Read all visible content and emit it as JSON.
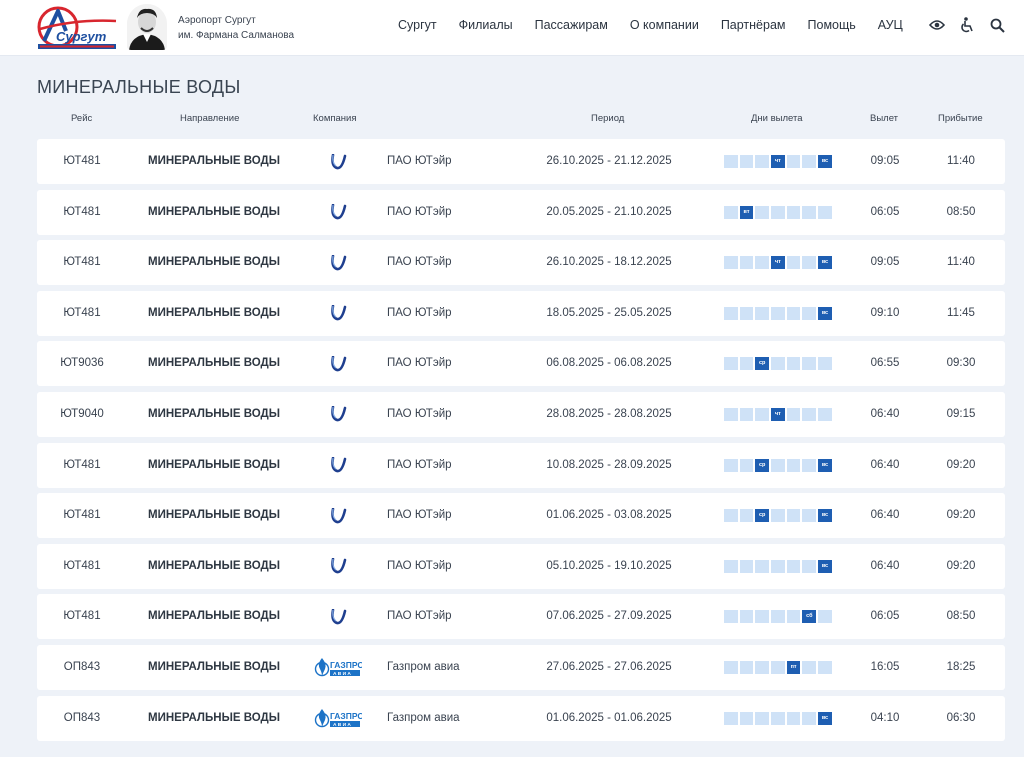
{
  "header": {
    "airport_line1": "Аэропорт Сургут",
    "airport_line2": "им. Фармана Салманова",
    "nav": [
      "Сургут",
      "Филиалы",
      "Пассажирам",
      "О компании",
      "Партнёрам",
      "Помощь",
      "АУЦ"
    ],
    "tools": [
      "eye-icon",
      "accessibility-icon",
      "search-icon"
    ]
  },
  "page_title": "МИНЕРАЛЬНЫЕ ВОДЫ",
  "columns": {
    "flight": "Рейс",
    "direction": "Направление",
    "company": "Компания",
    "period": "Период",
    "days": "Дни вылета",
    "departure": "Вылет",
    "arrival": "Прибытие"
  },
  "colors": {
    "accent": "#1e5eb2",
    "day_off": "#cfe2f7",
    "background": "#eef2f8"
  },
  "flights": [
    {
      "flight": "ЮТ481",
      "direction": "МИНЕРАЛЬНЫЕ ВОДЫ",
      "airline_icon": "utair-logo",
      "company": "ПАО ЮТэйр",
      "period": "26.10.2025 - 21.12.2025",
      "days": [
        {
          "d": 4,
          "label": "чт"
        },
        {
          "d": 7,
          "label": "вс"
        }
      ],
      "departure": "09:05",
      "arrival": "11:40"
    },
    {
      "flight": "ЮТ481",
      "direction": "МИНЕРАЛЬНЫЕ ВОДЫ",
      "airline_icon": "utair-logo",
      "company": "ПАО ЮТэйр",
      "period": "20.05.2025 - 21.10.2025",
      "days": [
        {
          "d": 2,
          "label": "вт"
        }
      ],
      "departure": "06:05",
      "arrival": "08:50"
    },
    {
      "flight": "ЮТ481",
      "direction": "МИНЕРАЛЬНЫЕ ВОДЫ",
      "airline_icon": "utair-logo",
      "company": "ПАО ЮТэйр",
      "period": "26.10.2025 - 18.12.2025",
      "days": [
        {
          "d": 4,
          "label": "чт"
        },
        {
          "d": 7,
          "label": "вс"
        }
      ],
      "departure": "09:05",
      "arrival": "11:40"
    },
    {
      "flight": "ЮТ481",
      "direction": "МИНЕРАЛЬНЫЕ ВОДЫ",
      "airline_icon": "utair-logo",
      "company": "ПАО ЮТэйр",
      "period": "18.05.2025 - 25.05.2025",
      "days": [
        {
          "d": 7,
          "label": "вс"
        }
      ],
      "departure": "09:10",
      "arrival": "11:45"
    },
    {
      "flight": "ЮТ9036",
      "direction": "МИНЕРАЛЬНЫЕ ВОДЫ",
      "airline_icon": "utair-logo",
      "company": "ПАО ЮТэйр",
      "period": "06.08.2025 - 06.08.2025",
      "days": [
        {
          "d": 3,
          "label": "ср"
        }
      ],
      "departure": "06:55",
      "arrival": "09:30"
    },
    {
      "flight": "ЮТ9040",
      "direction": "МИНЕРАЛЬНЫЕ ВОДЫ",
      "airline_icon": "utair-logo",
      "company": "ПАО ЮТэйр",
      "period": "28.08.2025 - 28.08.2025",
      "days": [
        {
          "d": 4,
          "label": "чт"
        }
      ],
      "departure": "06:40",
      "arrival": "09:15"
    },
    {
      "flight": "ЮТ481",
      "direction": "МИНЕРАЛЬНЫЕ ВОДЫ",
      "airline_icon": "utair-logo",
      "company": "ПАО ЮТэйр",
      "period": "10.08.2025 - 28.09.2025",
      "days": [
        {
          "d": 3,
          "label": "ср"
        },
        {
          "d": 7,
          "label": "вс"
        }
      ],
      "departure": "06:40",
      "arrival": "09:20"
    },
    {
      "flight": "ЮТ481",
      "direction": "МИНЕРАЛЬНЫЕ ВОДЫ",
      "airline_icon": "utair-logo",
      "company": "ПАО ЮТэйр",
      "period": "01.06.2025 - 03.08.2025",
      "days": [
        {
          "d": 3,
          "label": "ср"
        },
        {
          "d": 7,
          "label": "вс"
        }
      ],
      "departure": "06:40",
      "arrival": "09:20"
    },
    {
      "flight": "ЮТ481",
      "direction": "МИНЕРАЛЬНЫЕ ВОДЫ",
      "airline_icon": "utair-logo",
      "company": "ПАО ЮТэйр",
      "period": "05.10.2025 - 19.10.2025",
      "days": [
        {
          "d": 7,
          "label": "вс"
        }
      ],
      "departure": "06:40",
      "arrival": "09:20"
    },
    {
      "flight": "ЮТ481",
      "direction": "МИНЕРАЛЬНЫЕ ВОДЫ",
      "airline_icon": "utair-logo",
      "company": "ПАО ЮТэйр",
      "period": "07.06.2025 - 27.09.2025",
      "days": [
        {
          "d": 6,
          "label": "сб"
        }
      ],
      "departure": "06:05",
      "arrival": "08:50"
    },
    {
      "flight": "ОП843",
      "direction": "МИНЕРАЛЬНЫЕ ВОДЫ",
      "airline_icon": "gazprom-avia-logo",
      "company": "Газпром авиа",
      "period": "27.06.2025 - 27.06.2025",
      "days": [
        {
          "d": 5,
          "label": "пт"
        }
      ],
      "departure": "16:05",
      "arrival": "18:25"
    },
    {
      "flight": "ОП843",
      "direction": "МИНЕРАЛЬНЫЕ ВОДЫ",
      "airline_icon": "gazprom-avia-logo",
      "company": "Газпром авиа",
      "period": "01.06.2025 - 01.06.2025",
      "days": [
        {
          "d": 7,
          "label": "вс"
        }
      ],
      "departure": "04:10",
      "arrival": "06:30"
    }
  ]
}
